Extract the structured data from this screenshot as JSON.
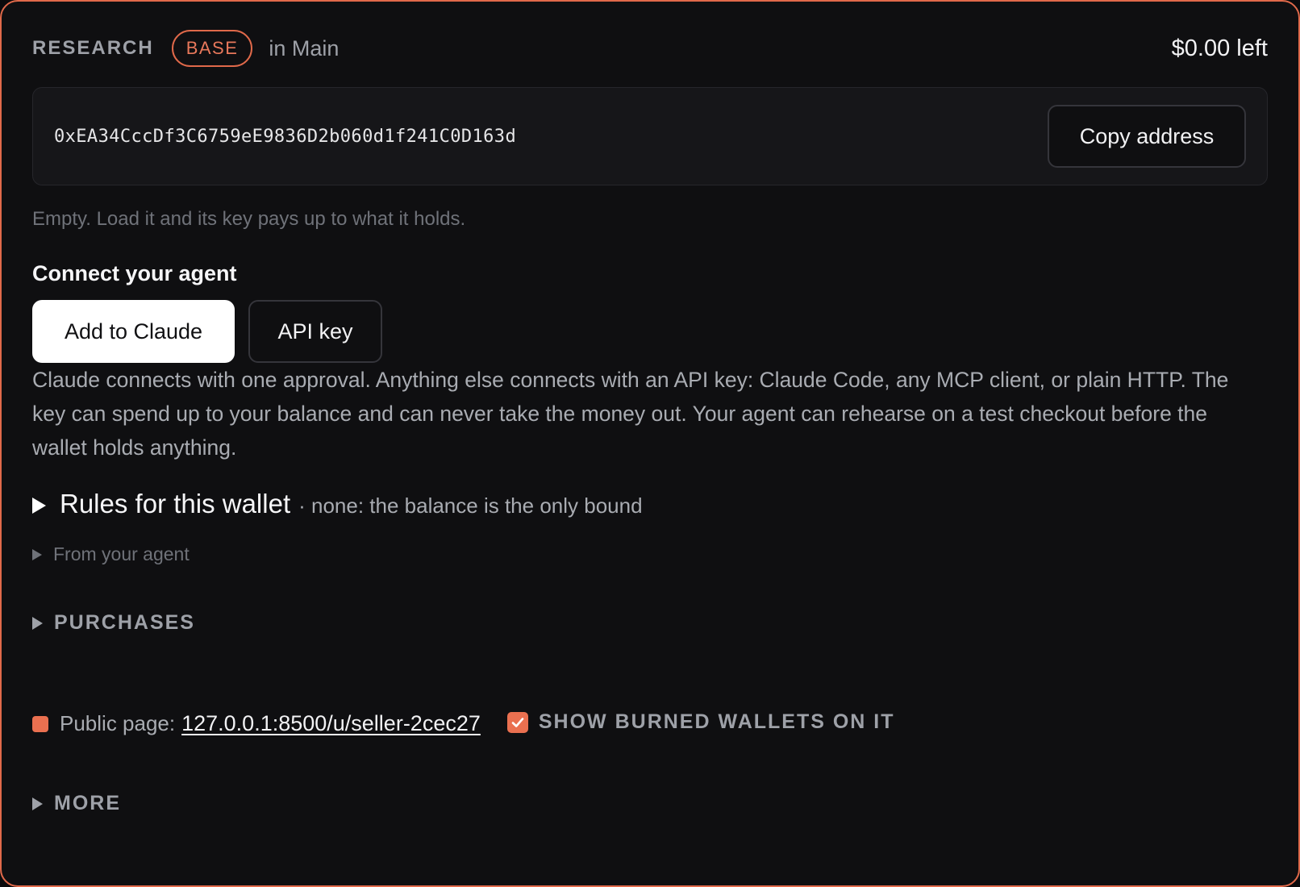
{
  "wallet": {
    "name": "RESEARCH",
    "chain": "BASE",
    "location": "in Main",
    "balance": "$0.00 left",
    "address": "0xEA34CccDf3C6759eE9836D2b060d1f241C0D163d",
    "copy_label": "Copy address",
    "hint": "Empty. Load it and its key pays up to what it holds."
  },
  "connect": {
    "title": "Connect your agent",
    "add_claude_label": "Add to Claude",
    "api_key_label": "API key",
    "description": "Claude connects with one approval. Anything else connects with an API key: Claude Code, any MCP client, or plain HTTP. The key can spend up to your balance and can never take the money out. Your agent can rehearse on a test checkout before the wallet holds anything."
  },
  "rules": {
    "title": "Rules for this wallet",
    "summary": "· none: the balance is the only bound",
    "from_agent": "From your agent"
  },
  "purchases": {
    "label": "PURCHASES"
  },
  "public_page": {
    "label": "Public page:",
    "link": "127.0.0.1:8500/u/seller-2cec27",
    "show_burned_label": "SHOW BURNED WALLETS ON IT",
    "show_burned_checked": true
  },
  "more": {
    "label": "MORE"
  },
  "colors": {
    "accent": "#e0694a",
    "background": "#0f0f11",
    "muted": "#9ea1a8"
  },
  "icons": {
    "rules_toggle": "triangle-right-icon",
    "from_agent_toggle": "triangle-right-icon",
    "purchases_toggle": "triangle-right-icon",
    "more_toggle": "triangle-right-icon",
    "public_status": "square-dot-icon",
    "checkbox": "checkmark-icon"
  }
}
